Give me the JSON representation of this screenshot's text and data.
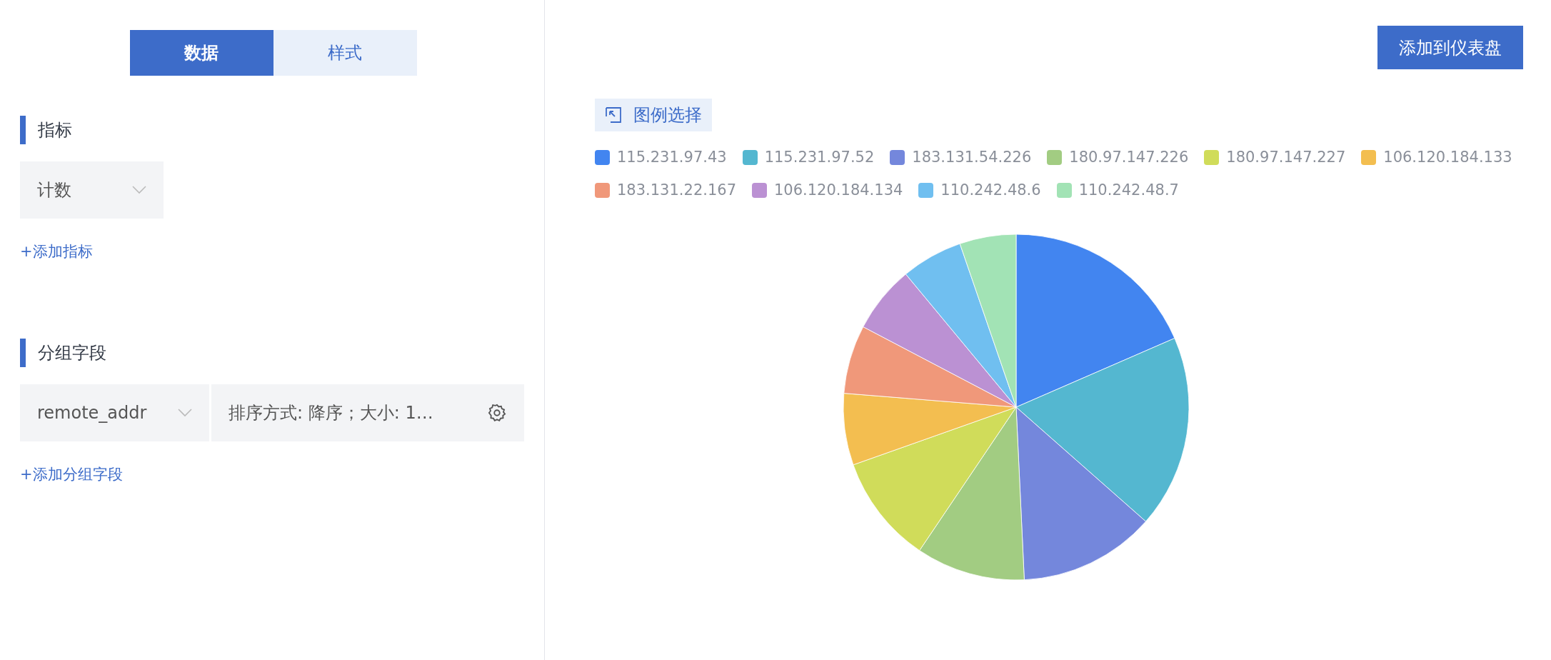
{
  "tabs": [
    {
      "label": "数据",
      "selected": true
    },
    {
      "label": "样式",
      "selected": false
    }
  ],
  "sections": [
    {
      "title": "指标",
      "fields": [
        {
          "kind": "select",
          "text": "计数"
        }
      ],
      "add_link": "+添加指标"
    },
    {
      "title": "分组字段",
      "fields": [
        {
          "kind": "select",
          "text": "remote_addr"
        },
        {
          "kind": "settings",
          "text": "排序方式: 降序；大小: 1…"
        }
      ],
      "add_link": "+添加分组字段"
    }
  ],
  "add_to_dashboard": "添加到仪表盘",
  "legend_select": "图例选择",
  "legend": [
    {
      "label": "115.231.97.43",
      "color": "#4285f0"
    },
    {
      "label": "115.231.97.52",
      "color": "#54b7d0"
    },
    {
      "label": "183.131.54.226",
      "color": "#7487dc"
    },
    {
      "label": "180.97.147.226",
      "color": "#a2cc82"
    },
    {
      "label": "180.97.147.227",
      "color": "#d0dc5a"
    },
    {
      "label": "106.120.184.133",
      "color": "#f3be50"
    },
    {
      "label": "183.131.22.167",
      "color": "#f0987a"
    },
    {
      "label": "106.120.184.134",
      "color": "#bb91d3"
    },
    {
      "label": "110.242.48.6",
      "color": "#70bff0"
    },
    {
      "label": "110.242.48.7",
      "color": "#a2e3b5"
    }
  ]
}
